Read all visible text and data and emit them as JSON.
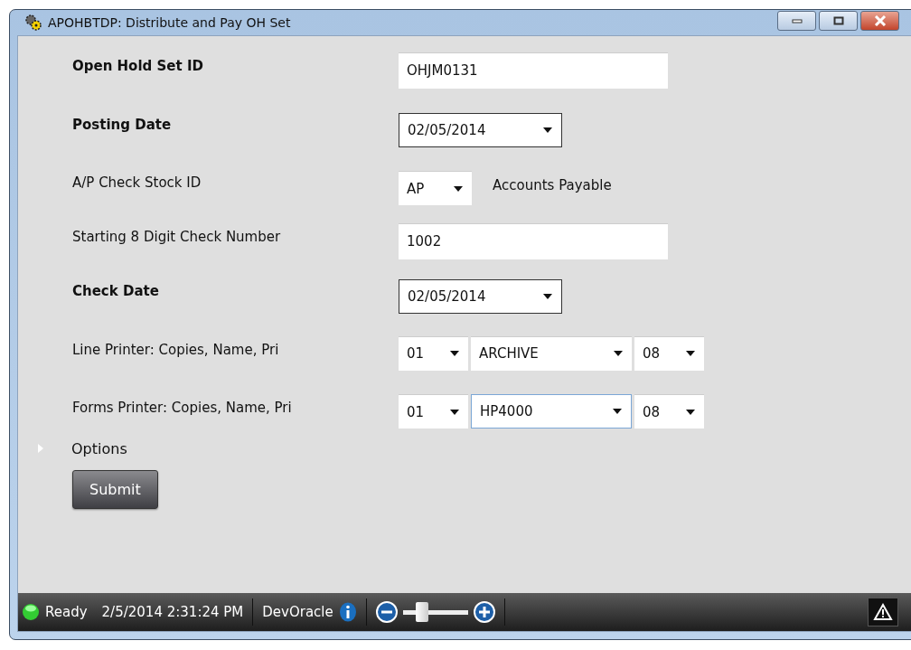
{
  "window": {
    "title": "APOHBTDP: Distribute and Pay OH Set"
  },
  "fields": [
    {
      "label": "Open Hold Set ID",
      "required": true,
      "kind": "text",
      "value": "OHJM0131"
    },
    {
      "label": "Posting Date",
      "required": true,
      "kind": "date",
      "value": "02/05/2014"
    },
    {
      "label": "A/P Check Stock ID",
      "required": false,
      "kind": "dropdown",
      "value": "AP",
      "note": "Accounts Payable"
    },
    {
      "label": "Starting 8 Digit Check Number",
      "required": false,
      "kind": "text",
      "value": "1002"
    },
    {
      "label": "Check Date",
      "required": true,
      "kind": "date",
      "value": "02/05/2014"
    },
    {
      "label": "Line Printer: Copies, Name, Pri",
      "required": false,
      "kind": "printer",
      "copies": "01",
      "name": "ARCHIVE",
      "name_focused": false,
      "priority": "08"
    },
    {
      "label": "Forms Printer: Copies, Name, Pri",
      "required": false,
      "kind": "printer",
      "copies": "01",
      "name": "HP4000",
      "name_focused": true,
      "priority": "08"
    }
  ],
  "options": {
    "label": "Options",
    "expanded": false
  },
  "submit": "Submit",
  "status_bar": {
    "status": "Ready",
    "datetime": "2/5/2014 2:31:24 PM",
    "environment": "DevOracle",
    "zoom": {
      "level": 0.3
    }
  }
}
